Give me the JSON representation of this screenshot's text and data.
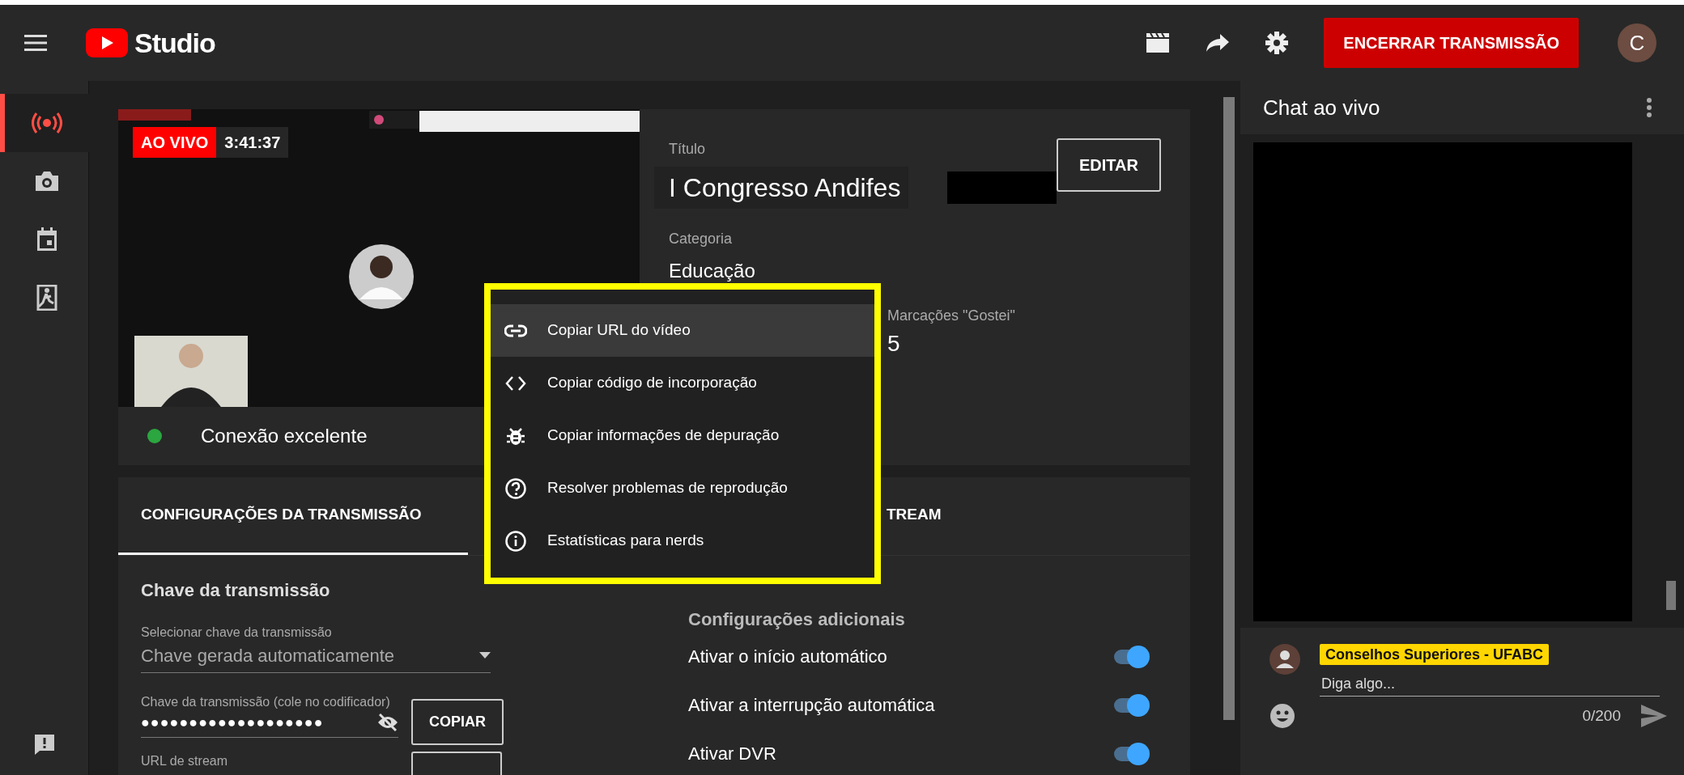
{
  "header": {
    "brand": "Studio",
    "end_button": "ENCERRAR TRANSMISSÃO",
    "avatar": "C"
  },
  "sidebar": {
    "items": [
      {
        "kind": "live",
        "selected": true
      },
      {
        "kind": "camera",
        "selected": false
      },
      {
        "kind": "calendar",
        "selected": false
      },
      {
        "kind": "exit",
        "selected": false
      }
    ]
  },
  "video": {
    "live_badge": "AO VIVO",
    "elapsed": "3:41:37",
    "kind": "picture"
  },
  "connection": {
    "status": "Conexão excelente"
  },
  "details": {
    "title_label": "Título",
    "title": "I Congresso Andifes",
    "edit_button": "EDITAR",
    "category_label": "Categoria",
    "category": "Educação",
    "likes_label": "Marcações \"Gostei\"",
    "likes": "5"
  },
  "settings": {
    "tabs": [
      {
        "label": "CONFIGURAÇÕES DA TRANSMISSÃO",
        "selected": true
      },
      {
        "label": "TREAM",
        "selected": false
      }
    ],
    "key_heading": "Chave da transmissão",
    "select_label": "Selecionar chave da transmissão",
    "select_value": "Chave gerada automaticamente",
    "key_label": "Chave da transmissão (cole no codificador)",
    "key_value": "●●●●●●●●●●●●●●●●●●●",
    "copy_button": "COPIAR",
    "url_label": "URL de stream",
    "extra_heading": "Configurações adicionais",
    "toggles": [
      {
        "label": "Ativar o início automático",
        "on": true
      },
      {
        "label": "Ativar a interrupção automática",
        "on": true
      },
      {
        "label": "Ativar DVR",
        "on": true
      }
    ]
  },
  "menu": {
    "items": [
      {
        "kind": "link",
        "label": "Copiar URL do vídeo",
        "selected": true
      },
      {
        "kind": "code",
        "label": "Copiar código de incorporação",
        "selected": false
      },
      {
        "kind": "bug",
        "label": "Copiar informações de depuração",
        "selected": false
      },
      {
        "kind": "help",
        "label": "Resolver problemas de reprodução",
        "selected": false
      },
      {
        "kind": "info",
        "label": "Estatísticas para nerds",
        "selected": false
      }
    ]
  },
  "chat": {
    "title": "Chat ao vivo",
    "author": "Conselhos Superiores - UFABC",
    "placeholder": "Diga algo...",
    "counter": "0/200"
  }
}
